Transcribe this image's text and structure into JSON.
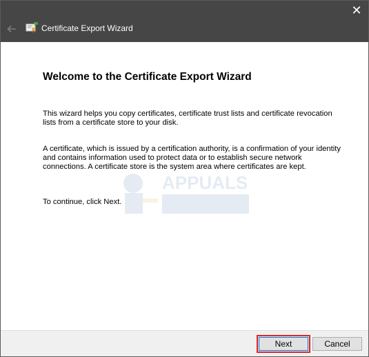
{
  "window": {
    "title": "Certificate Export Wizard",
    "close_glyph": "✕"
  },
  "content": {
    "heading": "Welcome to the Certificate Export Wizard",
    "paragraph1": "This wizard helps you copy certificates, certificate trust lists and certificate revocation lists from a certificate store to your disk.",
    "paragraph2": "A certificate, which is issued by a certification authority, is a confirmation of your identity and contains information used to protect data or to establish secure network connections. A certificate store is the system area where certificates are kept.",
    "paragraph3": "To continue, click Next."
  },
  "footer": {
    "next_label": "Next",
    "cancel_label": "Cancel"
  },
  "icons": {
    "back": "back-arrow-icon",
    "wizard": "certificate-wizard-icon",
    "close": "close-icon"
  },
  "colors": {
    "titlebar": "#464646",
    "highlight": "#d9222a",
    "footer": "#f0f0f0"
  }
}
